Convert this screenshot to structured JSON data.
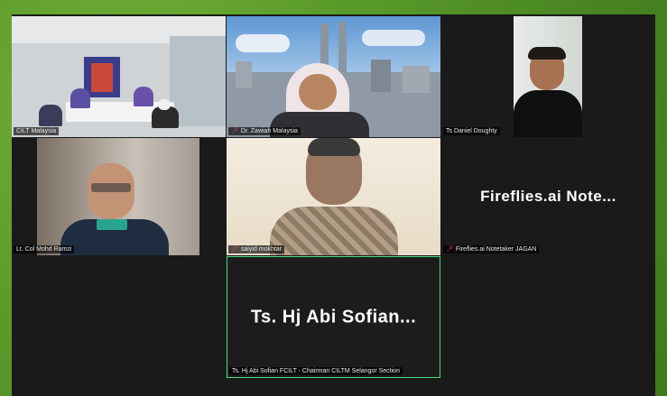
{
  "participants": [
    {
      "name": "CILT Malaysia",
      "muted": false
    },
    {
      "name": "Dr. Zawiah Malaysia",
      "muted": true
    },
    {
      "name": "Ts Daniel Doughty",
      "muted": false
    },
    {
      "name": "Lt. Col Mohd Ramzi",
      "muted": false
    },
    {
      "name": "saiyid mokhtar",
      "muted": true
    },
    {
      "name": "Fireflies.ai Notetaker JAGAN",
      "muted": true,
      "display_text": "Fireflies.ai  Note..."
    },
    {
      "name": "Ts. Hj Abi Sofian FCILT - Chairman  CILTM Selangor Section",
      "muted": false,
      "display_text": "Ts. Hj Abi Sofian..."
    }
  ],
  "colors": {
    "active_speaker_border": "#4ade80",
    "background_green": "#5d9a2c",
    "mute_icon": "#e04040"
  }
}
